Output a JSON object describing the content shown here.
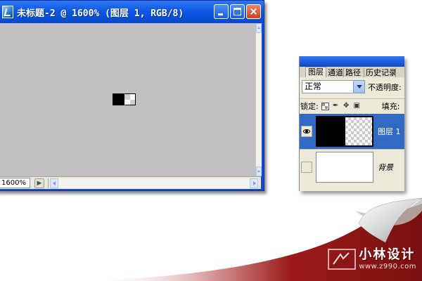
{
  "document_window": {
    "title": "未标题-2 @ 1600% (图层 1, RGB/8)",
    "buttons": {
      "minimize": "minimize",
      "maximize": "maximize",
      "close": "×"
    },
    "status": {
      "zoom": "1600%"
    }
  },
  "layers_palette": {
    "tabs": [
      {
        "label": "图层",
        "active": true
      },
      {
        "label": "通道"
      },
      {
        "label": "路径"
      },
      {
        "label": "历史记录"
      }
    ],
    "blend_mode": "正常",
    "opacity_label": "不透明度:",
    "lock_label": "锁定:",
    "fill_label": "填充:",
    "layers": [
      {
        "name": "图层 1",
        "visible": true,
        "selected": true
      },
      {
        "name": "背景",
        "visible": false,
        "selected": false
      }
    ]
  },
  "watermark": {
    "name": "小林设计",
    "url": "www.z990.com"
  },
  "colors": {
    "titlebar": "#0a4fd6",
    "canvas_bg": "#c0c0c0",
    "selection": "#316ac5",
    "curl_red": "#8e1414"
  }
}
